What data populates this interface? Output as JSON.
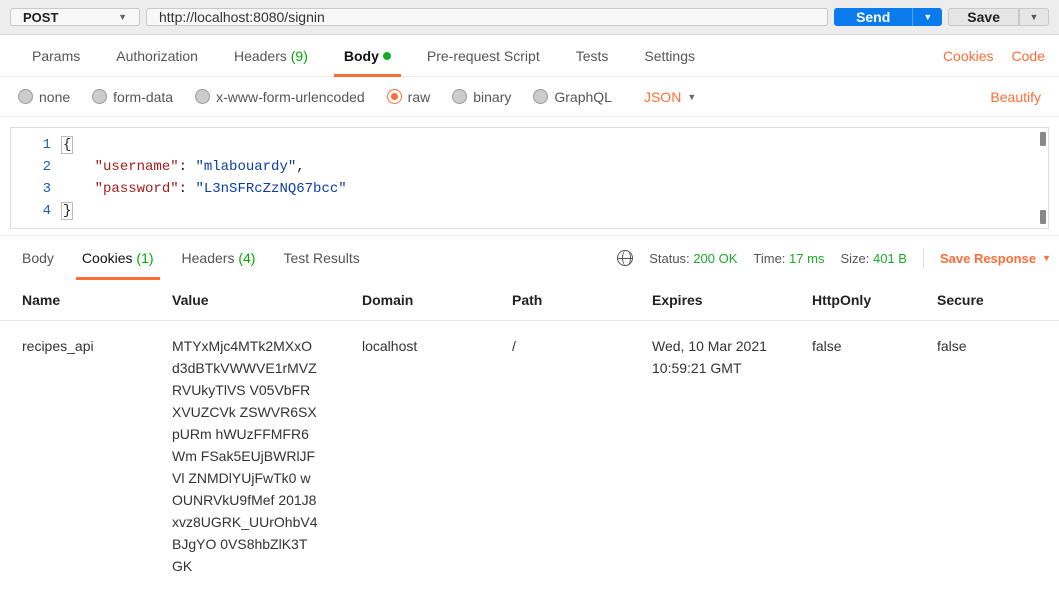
{
  "request": {
    "method": "POST",
    "url": "http://localhost:8080/signin",
    "send_label": "Send",
    "save_label": "Save"
  },
  "req_tabs": {
    "params": "Params",
    "authorization": "Authorization",
    "headers": "Headers",
    "headers_count": "(9)",
    "body": "Body",
    "prerequest": "Pre-request Script",
    "tests": "Tests",
    "settings": "Settings",
    "cookies": "Cookies",
    "code": "Code"
  },
  "body_types": {
    "none": "none",
    "formdata": "form-data",
    "xform": "x-www-form-urlencoded",
    "raw": "raw",
    "binary": "binary",
    "graphql": "GraphQL",
    "lang": "JSON",
    "beautify": "Beautify"
  },
  "editor": {
    "line1_open": "{",
    "line2_key": "\"username\"",
    "line2_sep": ": ",
    "line2_val": "\"mlabouardy\"",
    "line2_comma": ",",
    "line3_key": "\"password\"",
    "line3_sep": ": ",
    "line3_val": "\"L3nSFRcZzNQ67bcc\"",
    "line4_close": "}",
    "ln1": "1",
    "ln2": "2",
    "ln3": "3",
    "ln4": "4"
  },
  "resp_tabs": {
    "body": "Body",
    "cookies": "Cookies",
    "cookies_count": "(1)",
    "headers": "Headers",
    "headers_count": "(4)",
    "test_results": "Test Results"
  },
  "status": {
    "status_lbl": "Status:",
    "status_val": "200 OK",
    "time_lbl": "Time:",
    "time_val": "17 ms",
    "size_lbl": "Size:",
    "size_val": "401 B",
    "save_response": "Save Response"
  },
  "cookies_table": {
    "cols": {
      "name": "Name",
      "value": "Value",
      "domain": "Domain",
      "path": "Path",
      "expires": "Expires",
      "httponly": "HttpOnly",
      "secure": "Secure"
    },
    "row": {
      "name": "recipes_api",
      "value": "MTYxMjc4MTk2MXxOd3dBTkVWWVE1rMVZRVUkyTlVS V05VbFRXVUZCVk ZSWVR6SXpURm hWUzFFMFR6Wm FSak5EUjBWRlJFVl ZNMDlYUjFwTk0 wOUNRVkU9fMef 201J8xvz8UGRK_UUrOhbV4BJgYO 0VS8hbZlK3TGK",
      "domain": "localhost",
      "path": "/",
      "expires": "Wed, 10 Mar 2021 10:59:21 GMT",
      "httponly": "false",
      "secure": "false"
    }
  }
}
